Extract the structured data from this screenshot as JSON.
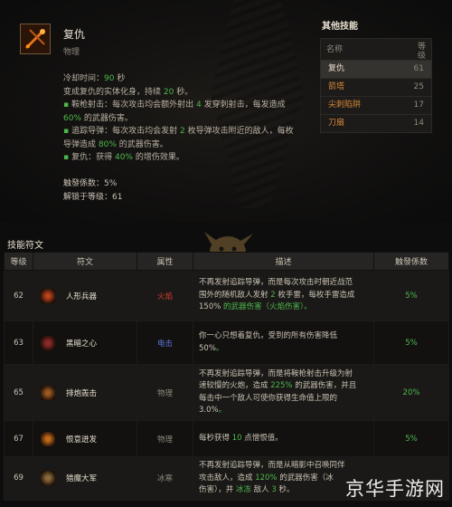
{
  "skill": {
    "name": "复仇",
    "type": "物理",
    "lines": [
      {
        "parts": [
          "冷却时间：",
          "90",
          " 秒"
        ]
      },
      {
        "parts": [
          "变成复仇的实体化身，持续 ",
          "20",
          " 秒。"
        ]
      },
      {
        "bullet": true,
        "parts": [
          "鞍枪射击：每次攻击均会额外射出 ",
          "4",
          " 发穿刺射击，每发造成"
        ]
      },
      {
        "parts": [
          "60%",
          " 的武器伤害。"
        ]
      },
      {
        "bullet": true,
        "parts": [
          "追踪导弹：每次攻击均会发射 ",
          "2",
          " 枚导弹攻击附近的敌人，每枚"
        ]
      },
      {
        "parts": [
          "导弹造成 ",
          "80%",
          " 的武器伤害。"
        ]
      },
      {
        "bullet": true,
        "parts": [
          "复仇：获得 ",
          "40%",
          " 的增伤效果。"
        ]
      }
    ],
    "ratio_label": "触發係数：5%",
    "unlock_label": "解锁于等级：61"
  },
  "other_skills": {
    "title": "其他技能",
    "col_name": "名称",
    "col_level": "等级",
    "rows": [
      {
        "name": "复仇",
        "level": "61",
        "selected": true
      },
      {
        "name": "箭塔",
        "level": "25"
      },
      {
        "name": "尖刺陷阱",
        "level": "17"
      },
      {
        "name": "刀扇",
        "level": "14"
      }
    ]
  },
  "runes": {
    "title": "技能符文",
    "headers": [
      "等级",
      "符文",
      "属性",
      "描述",
      "触發係数"
    ],
    "rows": [
      {
        "level": "62",
        "name": "人形兵器",
        "attr": "火焰",
        "attr_color": "#d33b2c",
        "ratio": "5%",
        "desc": [
          [
            "不再发射追踪导弹，而是每次攻击时朝近战范"
          ],
          [
            "围外的随机敌人发射 ",
            "2",
            " 枚手雷，每枚手雷造成"
          ],
          [
            "150%",
            " 的武器伤害（火焰伤害）。"
          ]
        ]
      },
      {
        "level": "63",
        "name": "黑暗之心",
        "attr": "电击",
        "attr_color": "#5a76d6",
        "ratio": "5%",
        "desc": [
          [
            "你一心只想着复仇，受到的所有伤害降低"
          ],
          [
            "50%",
            "。"
          ]
        ]
      },
      {
        "level": "65",
        "name": "排炮轰击",
        "attr": "物理",
        "attr_color": "#8e877b",
        "ratio": "20%",
        "desc": [
          [
            "不再发射追踪导弹，而是将鞍枪射击升级为射"
          ],
          [
            "速较慢的火炮，造成 ",
            "225%",
            " 的武器伤害，并且"
          ],
          [
            "每击中一个敌人可使你获得生命值上限的"
          ],
          [
            "3.0%",
            "。"
          ]
        ]
      },
      {
        "level": "67",
        "name": "恨意迸发",
        "attr": "物理",
        "attr_color": "#8e877b",
        "ratio": "5%",
        "desc": [
          [
            "每秒获得 ",
            "10",
            " 点憎恨值。"
          ]
        ]
      },
      {
        "level": "69",
        "name": "猎魔大军",
        "attr": "冰寒",
        "attr_color": "#8e877b",
        "ratio": "",
        "desc": [
          [
            "不再发射追踪导弹，而是从暗影中召唤同伴"
          ],
          [
            "攻击敌人，造成 ",
            "120%",
            " 的武器伤害（冰"
          ],
          [
            "伤害），并 ",
            "冰冻",
            " 敌人 ",
            "3",
            " 秒。"
          ]
        ]
      }
    ]
  },
  "watermark": "京华手游网"
}
